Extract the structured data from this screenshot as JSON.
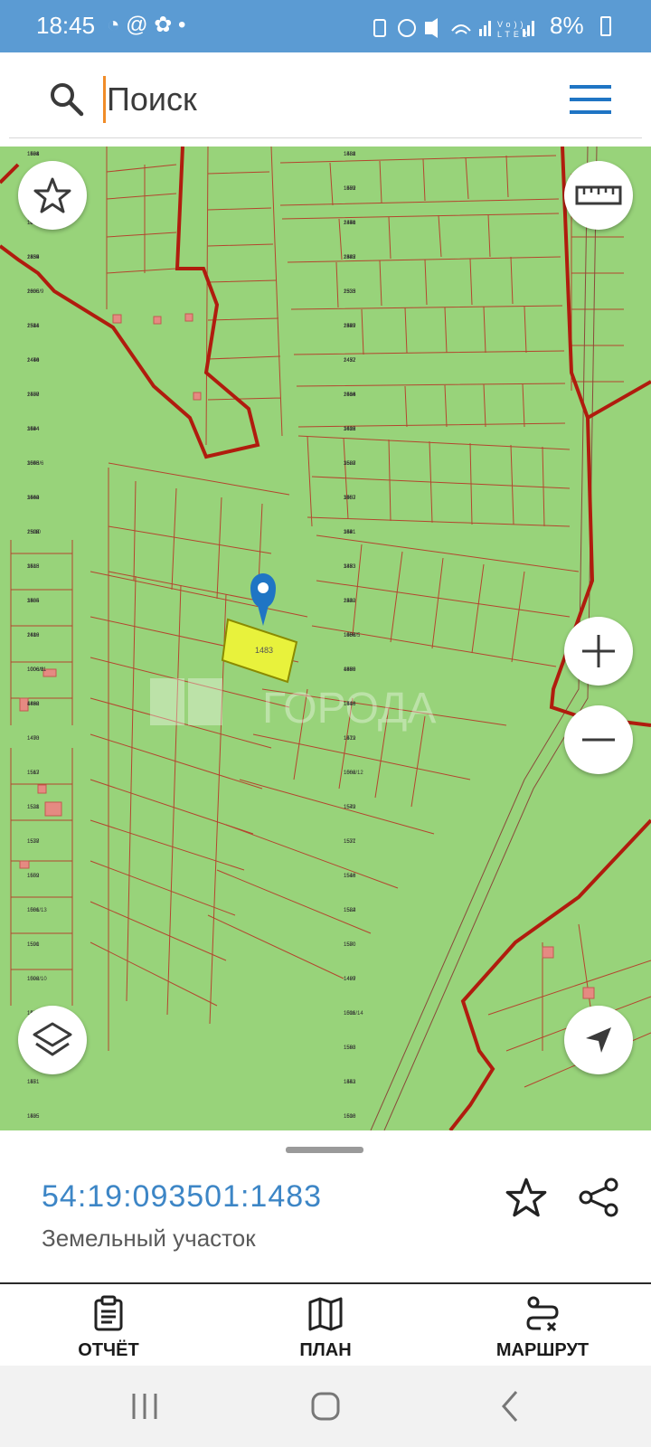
{
  "status_bar": {
    "time": "18:45",
    "left_icons": "◔ @ ✿ •",
    "battery": "8%"
  },
  "search": {
    "placeholder": "Поиск"
  },
  "map": {
    "selected_parcel_label": "1483",
    "watermark": "ГОРОДА",
    "parcel_labels": [
      "1491",
      "1482",
      "1449",
      "1509",
      "1006/7",
      "1450",
      "1434",
      "1445",
      "1006/9",
      "1535",
      "1514",
      "1459",
      "1440",
      "1457",
      "1507",
      "1506",
      "1494",
      "1492",
      "1006/6",
      "1508",
      "1504",
      "1503",
      "1502",
      "1431",
      "1488",
      "1433",
      "1505",
      "1432",
      "1489",
      "1487",
      "1006/8",
      "1469",
      "1488",
      "1516",
      "1490",
      "1512",
      "1563",
      "1562",
      "1521",
      "1579",
      "1578",
      "1577",
      "1559",
      "1546",
      "1581",
      "1522",
      "1590",
      "1580",
      "1006/10",
      "1499",
      "1436",
      "1511",
      "1510",
      "1568",
      "1451",
      "1452",
      "1435",
      "1510",
      "1568",
      "1431",
      "1435",
      "1477",
      "1446",
      "1478",
      "1555",
      "1582",
      "1606",
      "1533",
      "1544",
      "1547",
      "1466",
      "1437",
      "1458",
      "1614",
      "1534",
      "1613",
      "1545",
      "1583",
      "1442",
      "1467",
      "1526",
      "1541",
      "1515",
      "1473",
      "1484",
      "1530",
      "1616",
      "1550",
      "1006/11",
      "1575",
      "1462",
      "1448",
      "1473",
      "1479",
      "1517",
      "1006/12",
      "1538",
      "1542",
      "1537",
      "1531",
      "1602",
      "1518",
      "1006/13",
      "1584",
      "1591",
      "1570",
      "1592",
      "1487",
      "1586",
      "1006/14",
      "1524",
      "1593",
      "1571",
      "1543",
      "1595",
      "1608",
      "1594",
      "1588",
      "1587",
      "1552",
      "1521",
      "2341",
      "2339",
      "2337",
      "2335",
      "2333",
      "2331",
      "2329",
      "2474",
      "2472",
      "2470",
      "2468",
      "3644",
      "3626",
      "3653",
      "3627",
      "3660",
      "305",
      "23/10",
      "369",
      "35",
      "336",
      "338",
      "224",
      "241",
      "1006/5",
      "1006/1",
      "4880",
      "4890"
    ]
  },
  "selected": {
    "cadastral_number": "54:19:093501:1483",
    "type": "Земельный участок"
  },
  "bottom_nav": {
    "report": "ОТЧЁТ",
    "plan": "ПЛАН",
    "route": "МАРШРУТ"
  },
  "colors": {
    "status_bar": "#5b9bd3",
    "map_bg": "#98d37a",
    "parcel_line": "#b4452e",
    "border_line": "#b01c0e",
    "selected_parcel": "#e8f23c",
    "cad_number": "#3d86c6",
    "marker": "#1f75c4"
  },
  "icons": {
    "search": "search-icon",
    "menu": "menu-icon",
    "favorite": "star-icon",
    "ruler": "ruler-icon",
    "zoom_in": "plus-icon",
    "zoom_out": "minus-icon",
    "layers": "layers-icon",
    "locate": "navigation-arrow-icon",
    "share": "share-icon",
    "report": "clipboard-icon",
    "plan": "map-icon",
    "route": "route-icon"
  }
}
